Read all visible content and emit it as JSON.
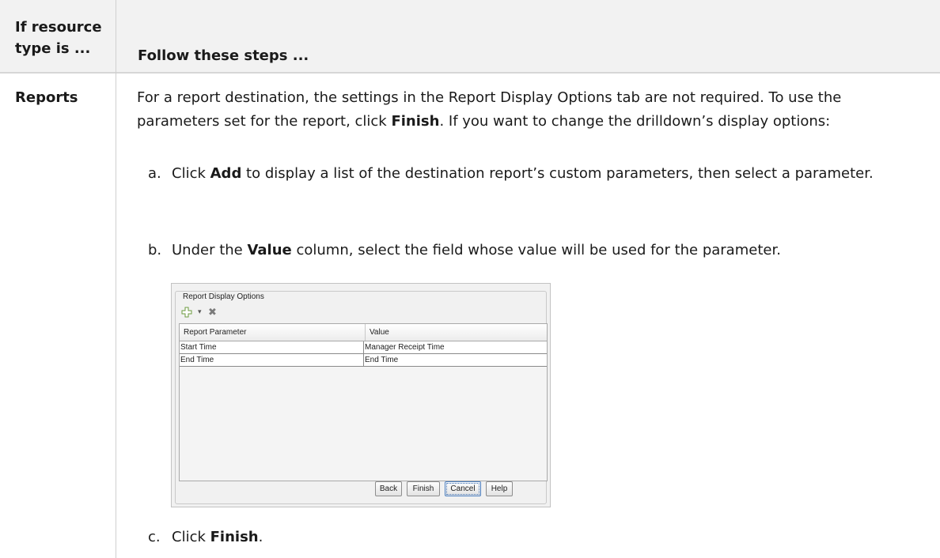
{
  "table": {
    "header": {
      "col1": "If resource type is ...",
      "col2": "Follow these steps ..."
    },
    "row": {
      "type": "Reports",
      "intro_1": "For a report destination, the settings in the Report Display Options tab are not required. To use the parameters set for the report, click ",
      "intro_bold": "Finish",
      "intro_2": ". If you want to change the drilldown’s display options:",
      "steps": [
        {
          "marker": "a.",
          "pre": "Click ",
          "bold": "Add",
          "post": " to display a list of the destination report’s custom parameters, then select a parameter."
        },
        {
          "marker": "b.",
          "pre": "Under the ",
          "bold": "Value",
          "post": " column, select the field whose value will be used for the parameter."
        },
        {
          "marker": "c.",
          "pre": "Click ",
          "bold": "Finish",
          "post": "."
        }
      ]
    }
  },
  "dialog": {
    "group_title": "Report Display Options",
    "toolbar": {
      "add_icon": "plus-icon",
      "dropdown_icon": "caret-down-icon",
      "delete_icon": "x-delete-icon"
    },
    "columns": [
      "Report Parameter",
      "Value"
    ],
    "rows": [
      [
        "Start Time",
        "Manager Receipt Time"
      ],
      [
        "End Time",
        "End Time"
      ]
    ],
    "buttons": {
      "back": "Back",
      "finish": "Finish",
      "cancel": "Cancel",
      "help": "Help"
    }
  }
}
